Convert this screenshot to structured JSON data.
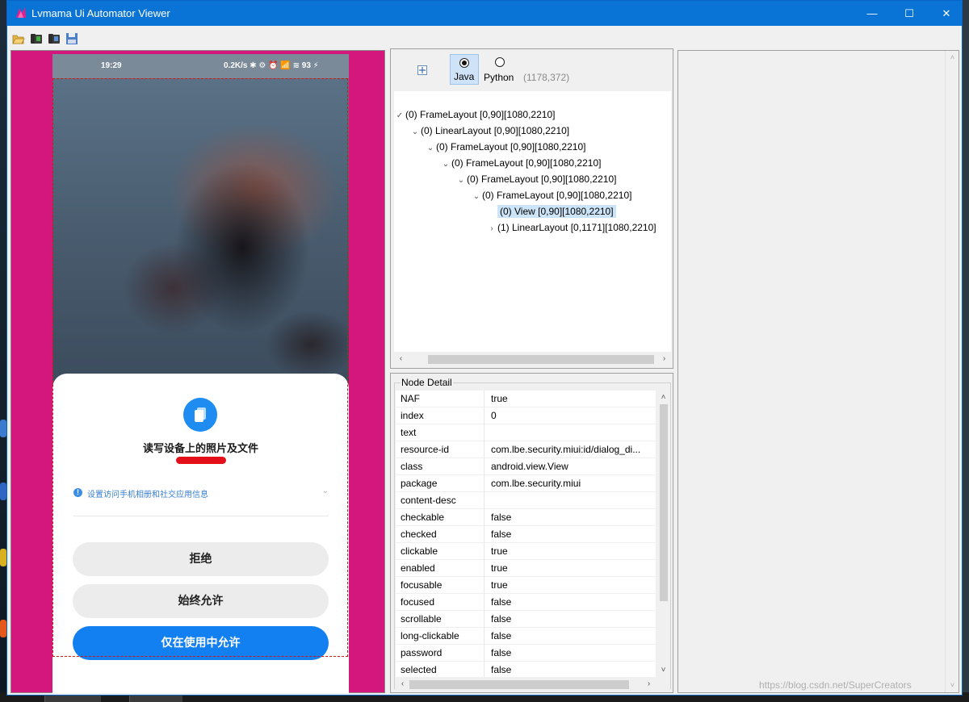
{
  "window": {
    "title": "Lvmama Ui Automator Viewer",
    "minimize_glyph": "—",
    "maximize_glyph": "☐",
    "close_glyph": "✕"
  },
  "toolbar": {
    "icons": [
      "open-folder-icon",
      "device-screenshot-icon",
      "device-screenshot-compressed-icon",
      "save-icon"
    ]
  },
  "device": {
    "status_time": "19:29",
    "status_right": "0.2K/s ✱ ⚙ ⏰ 📶 ≋ 93 ⚡",
    "dialog": {
      "title": "读写设备上的照片及文件",
      "info_text": "设置访问手机相册和社交应用信息",
      "info_glyph": "!",
      "chevron": "⌄",
      "deny_label": "拒绝",
      "always_allow_label": "始终允许",
      "allow_while_using_label": "仅在使用中允许"
    },
    "colors": {
      "frame": "#d4177d",
      "primary_button": "#1380f2",
      "underline_mark": "#e3101a"
    }
  },
  "hierarchy": {
    "expand_glyph": "+",
    "java_label": "Java",
    "python_label": "Python",
    "selected_mode": "Java",
    "coords": "(1178,372)",
    "tree": [
      {
        "twisty": "✓",
        "label": "(0) FrameLayout [0,90][1080,2210]"
      },
      {
        "twisty": "⌄",
        "label": "(0) LinearLayout [0,90][1080,2210]"
      },
      {
        "twisty": "⌄",
        "label": "(0) FrameLayout [0,90][1080,2210]"
      },
      {
        "twisty": "⌄",
        "label": "(0) FrameLayout [0,90][1080,2210]"
      },
      {
        "twisty": "⌄",
        "label": "(0) FrameLayout [0,90][1080,2210]"
      },
      {
        "twisty": "⌄",
        "label": "(0) FrameLayout [0,90][1080,2210]"
      },
      {
        "twisty": "",
        "label": "(0) View [0,90][1080,2210]"
      },
      {
        "twisty": "›",
        "label": "(1) LinearLayout [0,1171][1080,2210]"
      }
    ],
    "selected_node": "(0) View [0,90][1080,2210]"
  },
  "node_detail": {
    "legend": "Node Detail",
    "rows": [
      {
        "key": "NAF",
        "value": "true"
      },
      {
        "key": "index",
        "value": "0"
      },
      {
        "key": "text",
        "value": ""
      },
      {
        "key": "resource-id",
        "value": "com.lbe.security.miui:id/dialog_di..."
      },
      {
        "key": "class",
        "value": "android.view.View"
      },
      {
        "key": "package",
        "value": "com.lbe.security.miui"
      },
      {
        "key": "content-desc",
        "value": ""
      },
      {
        "key": "checkable",
        "value": "false"
      },
      {
        "key": "checked",
        "value": "false"
      },
      {
        "key": "clickable",
        "value": "true"
      },
      {
        "key": "enabled",
        "value": "true"
      },
      {
        "key": "focusable",
        "value": "true"
      },
      {
        "key": "focused",
        "value": "false"
      },
      {
        "key": "scrollable",
        "value": "false"
      },
      {
        "key": "long-clickable",
        "value": "false"
      },
      {
        "key": "password",
        "value": "false"
      },
      {
        "key": "selected",
        "value": "false"
      }
    ]
  },
  "scroll": {
    "left": "‹",
    "right": "›",
    "up": "˄",
    "down": "˅"
  },
  "watermark": "https://blog.csdn.net/SuperCreators"
}
